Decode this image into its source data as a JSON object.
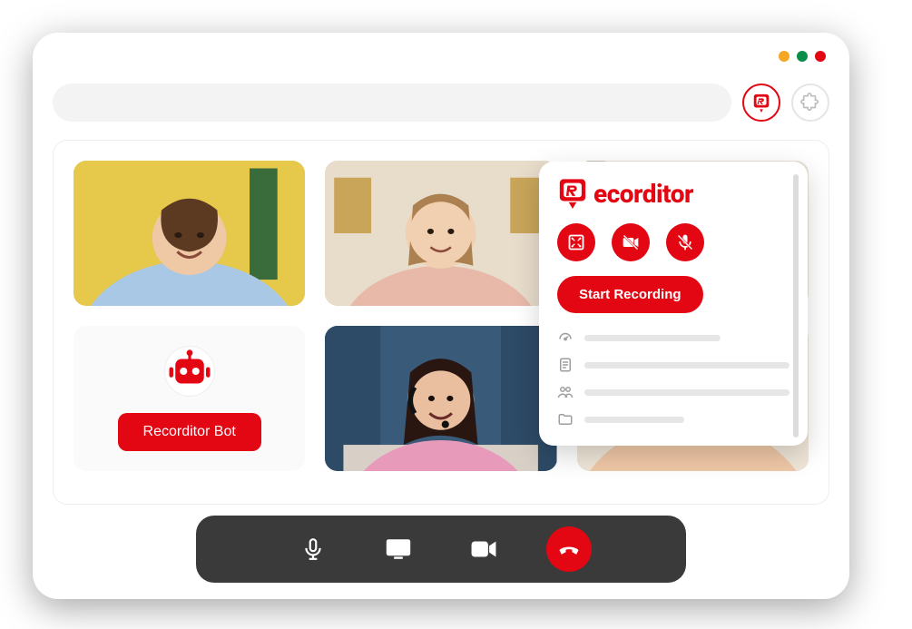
{
  "traffic_lights": [
    "orange",
    "green",
    "red"
  ],
  "toolbar": {
    "search_placeholder": "",
    "recorder_icon": "recorditor-logo-icon",
    "extension_icon": "puzzle-piece-icon"
  },
  "bot": {
    "label": "Recorditor Bot",
    "icon": "robot-icon"
  },
  "call_bar": {
    "buttons": [
      {
        "name": "microphone-icon"
      },
      {
        "name": "screen-icon"
      },
      {
        "name": "video-camera-icon"
      },
      {
        "name": "hangup-icon",
        "end": true
      }
    ]
  },
  "popup": {
    "brand": "ecorditor",
    "mode_icons": [
      "fullscreen-icon",
      "camera-off-icon",
      "mic-off-icon"
    ],
    "start_label": "Start Recording",
    "menu": [
      {
        "icon": "gauge-icon"
      },
      {
        "icon": "document-icon"
      },
      {
        "icon": "people-icon"
      },
      {
        "icon": "folder-icon"
      }
    ]
  }
}
